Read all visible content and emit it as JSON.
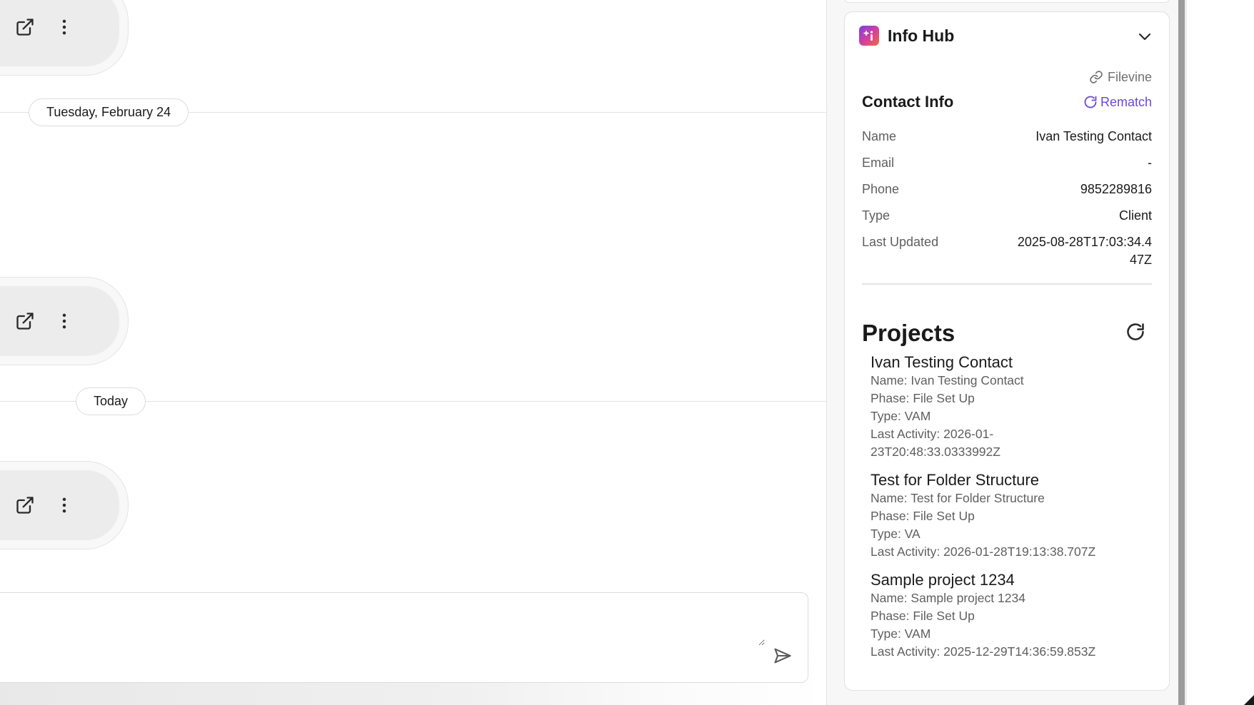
{
  "chat": {
    "date_separators": [
      {
        "label": "Tuesday, February 24"
      },
      {
        "label": "Today"
      }
    ],
    "composer": {
      "placeholder": ""
    }
  },
  "info_hub": {
    "title": "Info Hub",
    "source": "Filevine",
    "contact_section_title": "Contact Info",
    "rematch_label": "Rematch",
    "contact": [
      {
        "label": "Name",
        "value": "Ivan Testing Contact"
      },
      {
        "label": "Email",
        "value": "-"
      },
      {
        "label": "Phone",
        "value": "9852289816"
      },
      {
        "label": "Type",
        "value": "Client"
      },
      {
        "label": "Last Updated",
        "value": "2025-08-28T17:03:34.447Z"
      }
    ],
    "projects_title": "Projects",
    "projects": [
      {
        "title": "Ivan Testing Contact",
        "name": "Name: Ivan Testing Contact",
        "phase": "Phase: File Set Up",
        "type": "Type: VAM",
        "last_activity": "Last Activity: 2026-01-23T20:48:33.0333992Z"
      },
      {
        "title": "Test for Folder Structure",
        "name": "Name: Test for Folder Structure",
        "phase": "Phase: File Set Up",
        "type": "Type: VA",
        "last_activity": "Last Activity: 2026-01-28T19:13:38.707Z"
      },
      {
        "title": "Sample project 1234",
        "name": "Name: Sample project 1234",
        "phase": "Phase: File Set Up",
        "type": "Type: VAM",
        "last_activity": "Last Activity: 2025-12-29T14:36:59.853Z"
      }
    ]
  },
  "colors": {
    "accent": "#6b48d8",
    "muted_text": "#5f5f5f",
    "border": "#e2e2e2",
    "bubble_fill": "#ececec"
  },
  "icons": {
    "open_external": "external-link-icon",
    "more_options": "more-vertical-icon",
    "send": "send-icon",
    "collapse": "chevron-down-icon",
    "source_link": "link-icon",
    "rematch": "refresh-icon",
    "refresh_projects": "refresh-icon",
    "hub_logo": "info-hub-logo-icon"
  }
}
